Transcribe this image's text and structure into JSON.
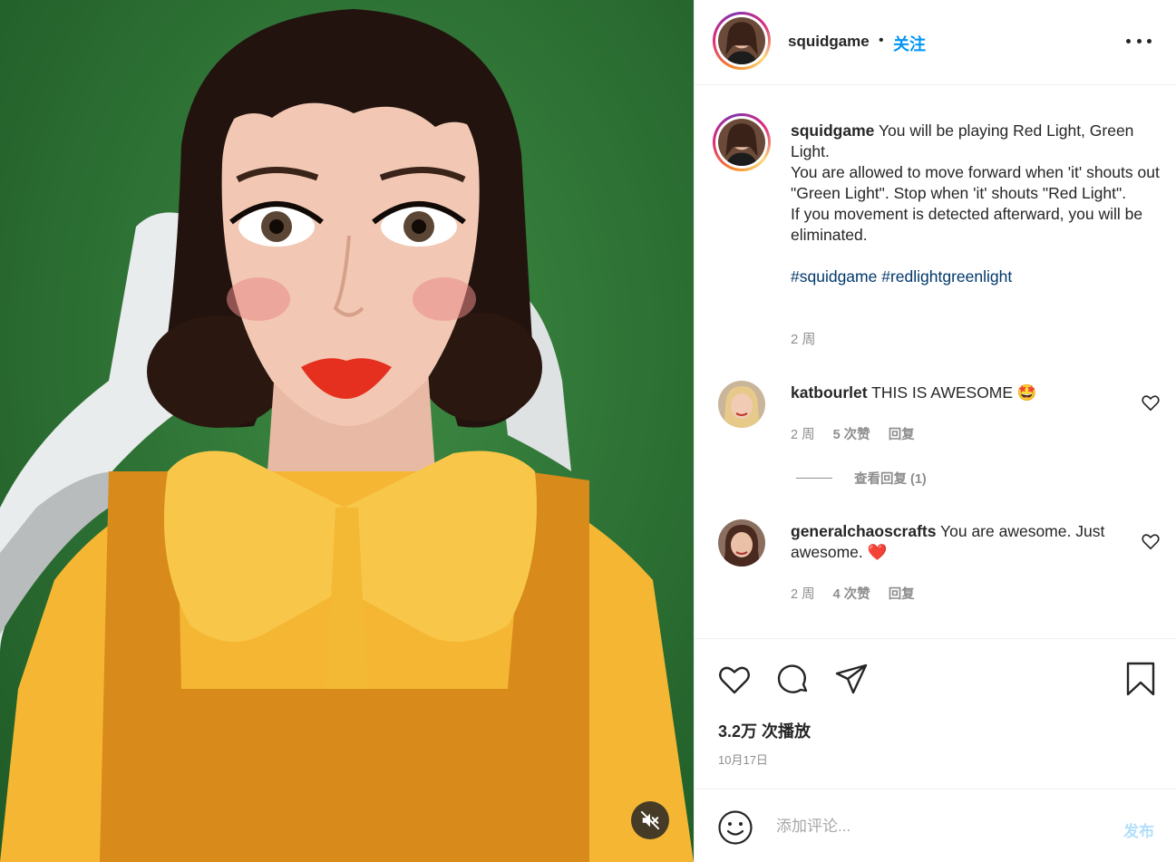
{
  "post": {
    "username": "squidgame",
    "follow_label": "关注",
    "dot": "•",
    "more_icon": "more-horizontal-icon",
    "caption": {
      "username": "squidgame",
      "lines": [
        "You will be playing Red Light, Green Light.",
        "You are allowed to move forward when 'it' shouts out \"Green Light\". Stop when 'it' shouts \"Red Light\".",
        "If you movement is detected afterward, you will be eliminated."
      ],
      "hashtags": "#squidgame #redlightgreenlight",
      "time": "2 周"
    },
    "comments": [
      {
        "username": "katbourlet",
        "text": "THIS IS AWESOME 🤩",
        "time": "2 周",
        "likes": "5 次赞",
        "reply": "回复",
        "view_replies": "查看回复 (1)"
      },
      {
        "username": "generalchaoscrafts",
        "text": "You are awesome. Just awesome. ❤️",
        "time": "2 周",
        "likes": "4 次赞",
        "reply": "回复"
      }
    ],
    "views": "3.2万 次播放",
    "date": "10月17日",
    "comment_placeholder": "添加评论...",
    "post_label": "发布"
  },
  "colors": {
    "accent": "#0095f6",
    "hashtag": "#00376b",
    "muted": "#8e8e8e",
    "post_disabled": "#b2dffc",
    "background_green": "#2f7436"
  }
}
